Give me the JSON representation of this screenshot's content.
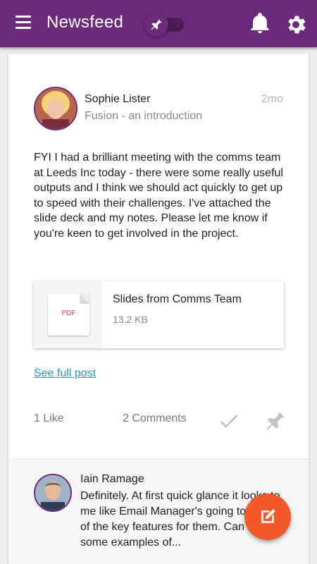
{
  "appbar": {
    "title": "Newsfeed",
    "color": "#6b2a7b",
    "icons": [
      "menu-icon",
      "pin-icon",
      "bell-icon",
      "gear-icon"
    ],
    "toggle_on": false
  },
  "post": {
    "author": "Sophie Lister",
    "subtitle": "Fusion - an introduction",
    "time": "2mo",
    "body": "FYI I had a brilliant meeting with the comms team at Leeds Inc today - there were some really useful outputs and I think we should act quickly to get up to speed with their challenges. I've attached the slide deck and my notes. Please let me know if you're keen to get involved in the project.",
    "attachment": {
      "type_label": "PDF",
      "name": "Slides from Comms Team",
      "size": "13.2 KB"
    },
    "see_full_post": "See full post",
    "likes": "1 Like",
    "comments": "2 Comments"
  },
  "comment": {
    "author": "Iain Ramage",
    "text": "Definitely. At first quick glance it looks to me like Email Manager's going to be one of the key features for them. Can we get some examples of..."
  },
  "fab": {
    "icon": "edit-icon",
    "color": "#f2582a"
  }
}
